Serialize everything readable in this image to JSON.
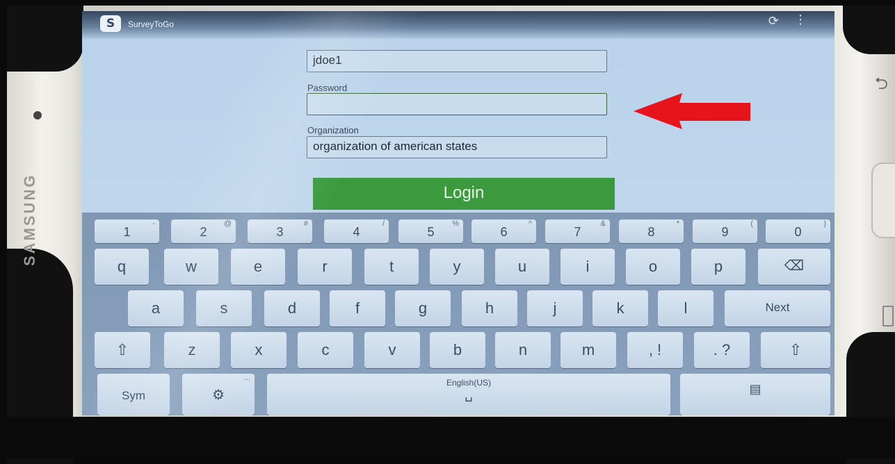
{
  "app": {
    "title": "SurveyToGo",
    "logo_text": "S"
  },
  "device": {
    "brand": "SAMSUNG"
  },
  "form": {
    "username_value": "jdoe1",
    "password_label": "Password",
    "password_value": "",
    "organization_label": "Organization",
    "organization_value": "organization of american states",
    "login_label": "Login"
  },
  "keyboard": {
    "number_row": [
      {
        "label": "1",
        "hint": "-"
      },
      {
        "label": "2",
        "hint": "@"
      },
      {
        "label": "3",
        "hint": "#"
      },
      {
        "label": "4",
        "hint": "/"
      },
      {
        "label": "5",
        "hint": "%"
      },
      {
        "label": "6",
        "hint": "^"
      },
      {
        "label": "7",
        "hint": "&"
      },
      {
        "label": "8",
        "hint": "*"
      },
      {
        "label": "9",
        "hint": "("
      },
      {
        "label": "0",
        "hint": ")"
      }
    ],
    "row1": [
      "q",
      "w",
      "e",
      "r",
      "t",
      "y",
      "u",
      "i",
      "o",
      "p"
    ],
    "row2": [
      "a",
      "s",
      "d",
      "f",
      "g",
      "h",
      "j",
      "k",
      "l"
    ],
    "row3": [
      "z",
      "x",
      "c",
      "v",
      "b",
      "n",
      "m"
    ],
    "next_label": "Next",
    "comma_label": ", !",
    "period_label": ". ?",
    "sym_label": "Sym",
    "space_label": "English(US)",
    "settings_hint": "..."
  },
  "colors": {
    "login_green": "#3c9a3e",
    "annotation_arrow": "#e8141c"
  }
}
